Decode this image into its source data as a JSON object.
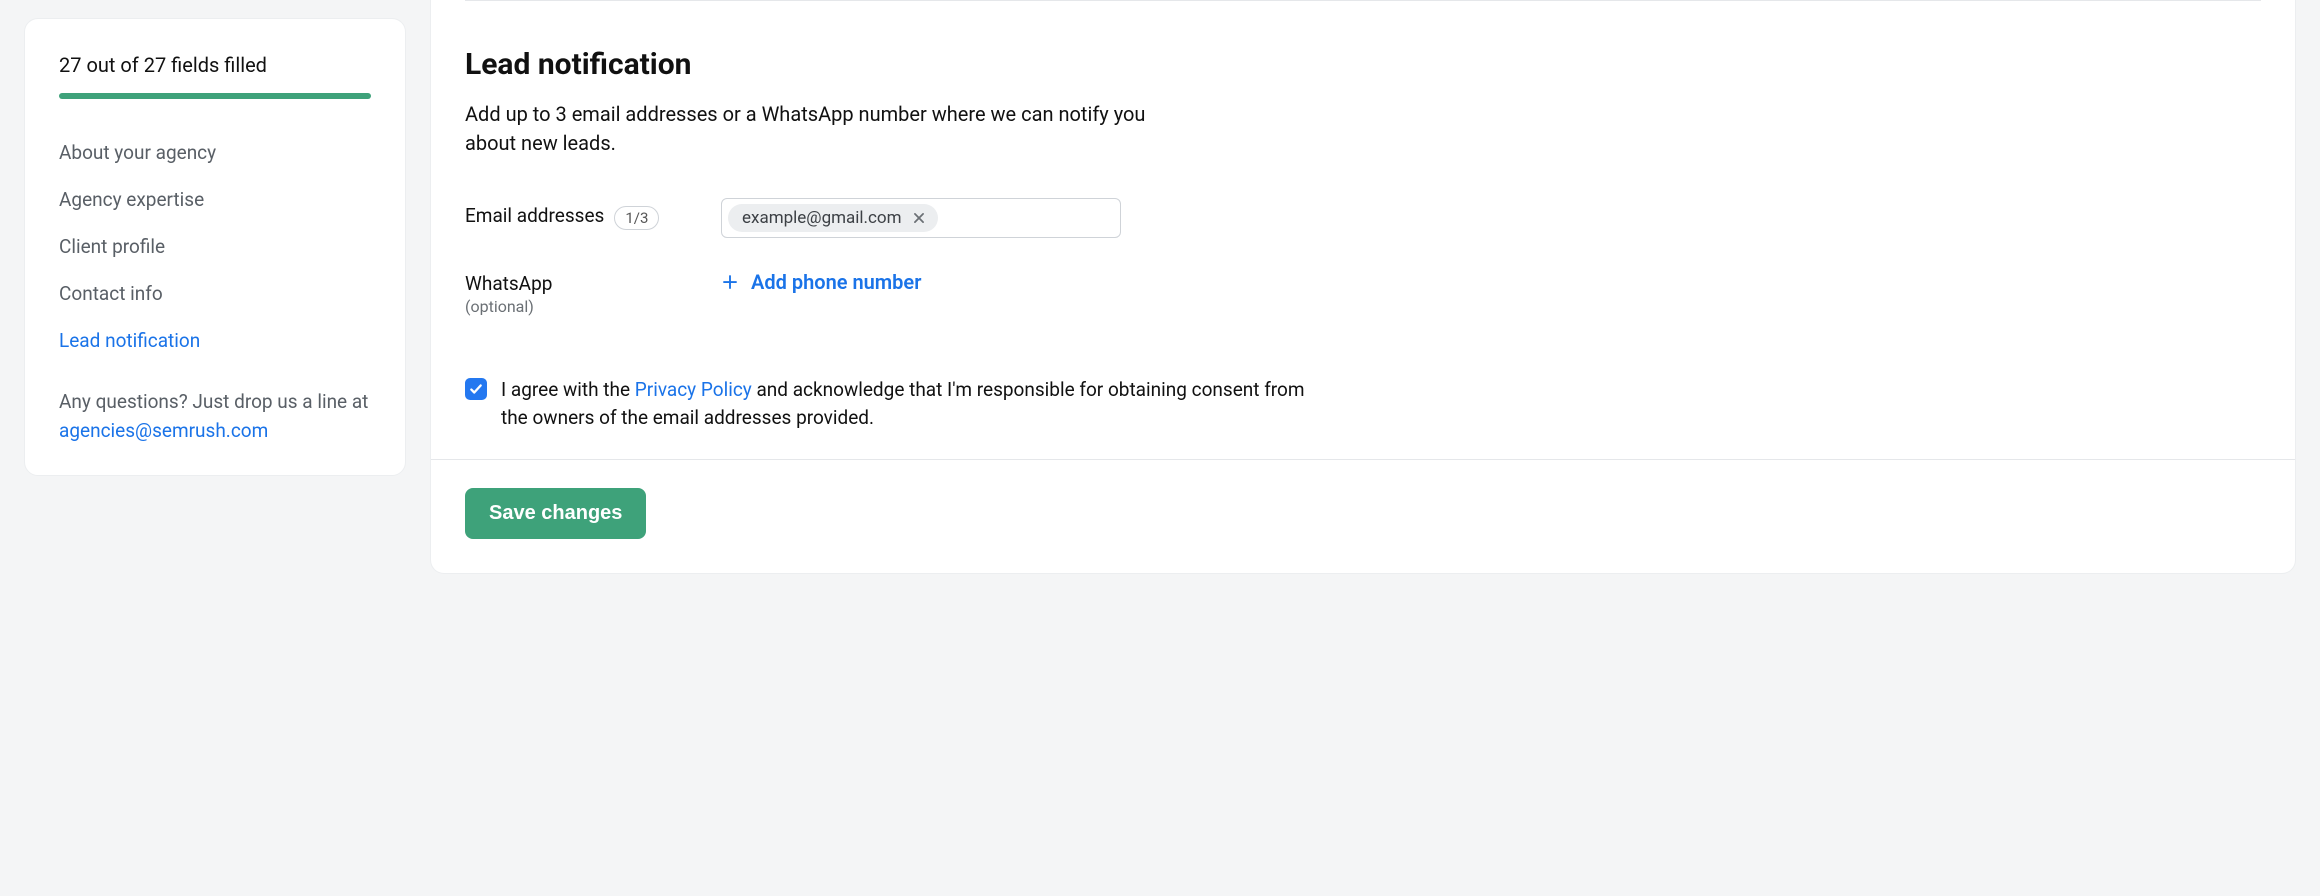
{
  "sidebar": {
    "progress_text": "27 out of 27 fields filled",
    "items": [
      {
        "label": "About your agency",
        "active": false
      },
      {
        "label": "Agency expertise",
        "active": false
      },
      {
        "label": "Client profile",
        "active": false
      },
      {
        "label": "Contact info",
        "active": false
      },
      {
        "label": "Lead notification",
        "active": true
      }
    ],
    "help_prefix": "Any questions? Just drop us a line at ",
    "help_email": "agencies@semrush.com"
  },
  "main": {
    "title": "Lead notification",
    "description": "Add up to 3 email addresses or a WhatsApp number where we can notify you about new leads.",
    "email_label": "Email addresses",
    "email_count_badge": "1/3",
    "email_chips": [
      {
        "value": "example@gmail.com"
      }
    ],
    "whatsapp_label": "WhatsApp",
    "whatsapp_optional": "(optional)",
    "add_phone_label": "Add phone number",
    "consent_prefix": "I agree with the ",
    "consent_link": "Privacy Policy",
    "consent_suffix": " and acknowledge that I'm responsible for obtaining consent from the owners of the email addresses provided.",
    "save_label": "Save changes"
  }
}
